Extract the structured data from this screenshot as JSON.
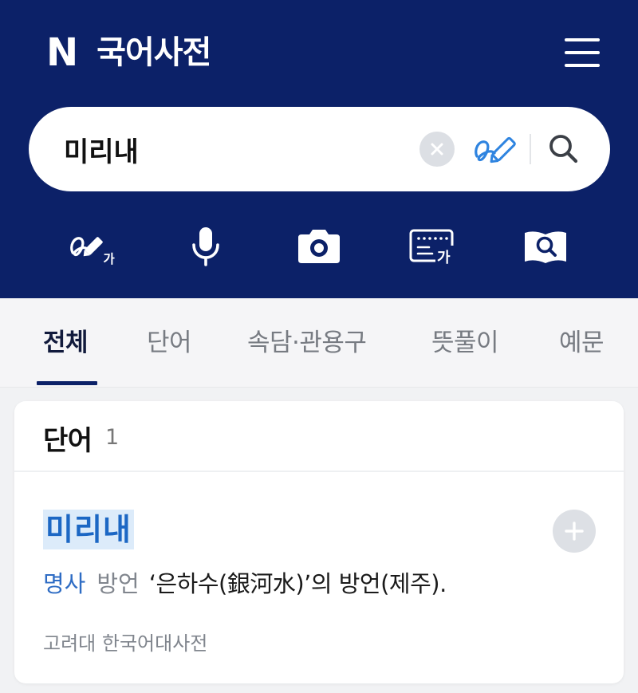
{
  "header": {
    "logo": "N",
    "title": "국어사전"
  },
  "search": {
    "query": "미리내",
    "placeholder": ""
  },
  "tools": {
    "handwriting_char": "가",
    "keyboard_char": "가"
  },
  "tabs": [
    {
      "label": "전체",
      "active": true
    },
    {
      "label": "단어",
      "active": false
    },
    {
      "label": "속담·관용구",
      "active": false
    },
    {
      "label": "뜻풀이",
      "active": false
    },
    {
      "label": "예문",
      "active": false
    }
  ],
  "results": {
    "section_title": "단어",
    "count": "1",
    "entry": {
      "word": "미리내",
      "part_of_speech": "명사",
      "usage": "방언",
      "definition": "‘은하수(銀河水)’의 방언(제주).",
      "source": "고려대 한국어대사전"
    }
  },
  "colors": {
    "header_bg": "#0c2168",
    "accent_blue": "#1c67c4",
    "highlight": "#dcebfa"
  }
}
